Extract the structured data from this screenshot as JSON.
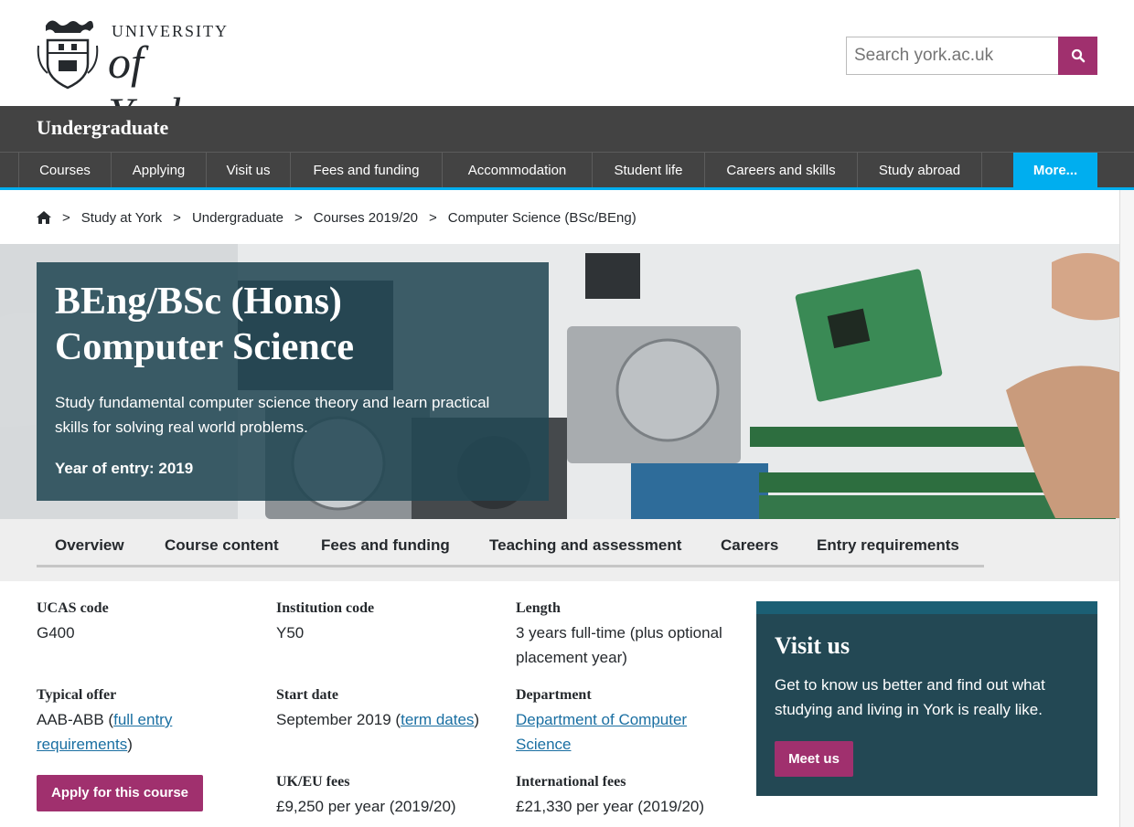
{
  "header": {
    "logo_university": "UNIVERSITY",
    "logo_york": "of York",
    "search_placeholder": "Search york.ac.uk"
  },
  "section": {
    "title": "Undergraduate"
  },
  "nav": {
    "items": [
      "Courses",
      "Applying",
      "Visit us",
      "Fees and funding",
      "Accommodation",
      "Student life",
      "Careers and skills",
      "Study abroad"
    ],
    "more": "More..."
  },
  "breadcrumb": [
    "Study at York",
    "Undergraduate",
    "Courses 2019/20",
    "Computer Science (BSc/BEng)"
  ],
  "hero": {
    "title_line1": "BEng/BSc (Hons)",
    "title_line2": "Computer Science",
    "subtitle": "Study fundamental computer science theory and learn practical skills for solving real world problems.",
    "entry": "Year of entry: 2019"
  },
  "tabs": [
    "Overview",
    "Course content",
    "Fees and funding",
    "Teaching and assessment",
    "Careers",
    "Entry requirements"
  ],
  "facts": {
    "ucas_label": "UCAS code",
    "ucas_value": "G400",
    "inst_label": "Institution code",
    "inst_value": "Y50",
    "length_label": "Length",
    "length_value": "3 years full-time (plus optional placement year)",
    "offer_label": "Typical offer",
    "offer_prefix": "AAB-ABB (",
    "offer_link": "full entry requirements",
    "offer_suffix": ")",
    "start_label": "Start date",
    "start_prefix": "September 2019 (",
    "start_link": "term dates",
    "start_suffix": ")",
    "dept_label": "Department",
    "dept_link": "Department of Computer Science",
    "uk_fees_label": "UK/EU fees",
    "uk_fees_value": "£9,250 per year (2019/20)",
    "intl_fees_label": "International fees",
    "intl_fees_value": "£21,330 per year (2019/20)",
    "apply_label": "Apply for this course"
  },
  "visit": {
    "title": "Visit us",
    "text": "Get to know us better and find out what studying and living in York is really like.",
    "button": "Meet us"
  },
  "colors": {
    "accent": "#a0306e",
    "nav_bg": "#434343",
    "nav_highlight": "#00aeef",
    "panel": "#234854",
    "link": "#1a6fa2"
  }
}
